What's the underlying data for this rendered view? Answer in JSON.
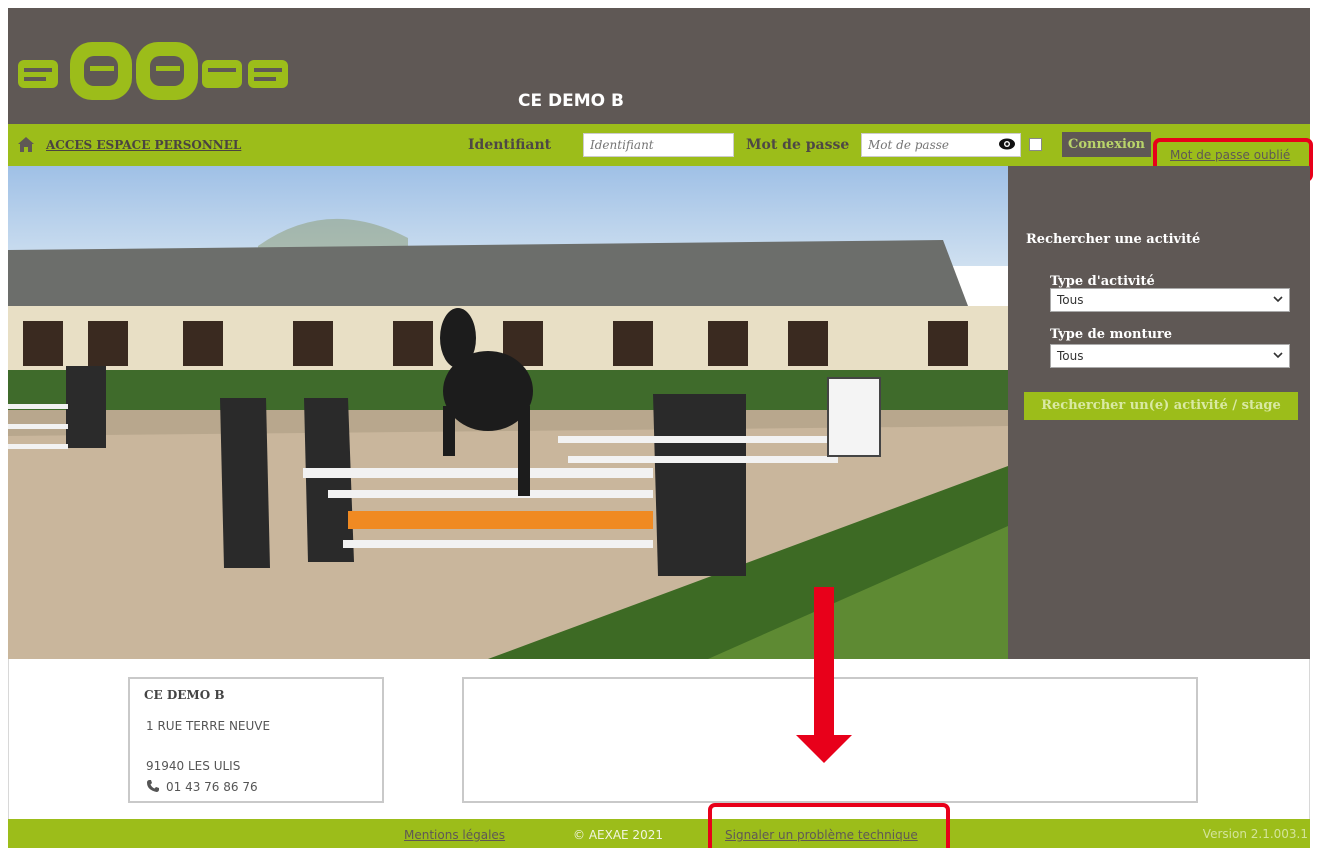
{
  "header": {
    "logo_text": "aexae",
    "site_title": "CE DEMO B"
  },
  "navbar": {
    "home_link": "ACCES ESPACE PERSONNEL",
    "login_label": "Identifiant",
    "login_placeholder": "Identifiant",
    "password_label": "Mot de passe",
    "password_placeholder": "Mot de passe",
    "connect_button": "Connexion",
    "forgot_link": "Mot de passe oublié"
  },
  "search": {
    "title": "Rechercher une activité",
    "activity_type_label": "Type d'activité",
    "activity_type_value": "Tous",
    "mount_type_label": "Type de monture",
    "mount_type_value": "Tous",
    "button": "Rechercher un(e) activité / stage"
  },
  "contact": {
    "name": "CE DEMO B",
    "address": "1 RUE TERRE NEUVE",
    "city": "91940 LES ULIS",
    "phone": "01 43 76 86 76"
  },
  "footer": {
    "legal_link": "Mentions légales",
    "copyright": "© AEXAE 2021",
    "report_link": "Signaler un problème technique",
    "version": "Version 2.1.003.1"
  },
  "colors": {
    "brand_green": "#9cbd1a",
    "brand_gray": "#5f5855",
    "highlight_red": "#e8001a"
  },
  "icons": [
    "home-icon",
    "eye-icon",
    "chevron-down-icon",
    "phone-icon"
  ]
}
